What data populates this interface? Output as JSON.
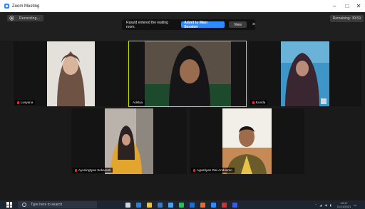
{
  "window": {
    "title": "Zoom Meeting"
  },
  "top": {
    "recording_label": "Recording...",
    "view_label": "Remaining: 39:59"
  },
  "waiting_notice": {
    "message": "Rasyid entered the waiting room.",
    "admit_label": "Admit to Main Session",
    "view_label": "View",
    "close_glyph": "×"
  },
  "participants": [
    {
      "name": "Lusyana"
    },
    {
      "name": "Adelya"
    },
    {
      "name": "Kunda"
    },
    {
      "name": "Ayuningtyas Sekaresti"
    },
    {
      "name": "Agustiyan Dwi Andrianto"
    }
  ],
  "taskbar": {
    "search_placeholder": "Type here to search",
    "time": "10:17",
    "date": "11/11/2021"
  },
  "colors": {
    "accent": "#2d8cff",
    "active_speaker": "#c6e000",
    "muted_mic": "#e22233"
  }
}
